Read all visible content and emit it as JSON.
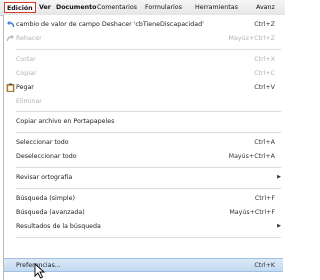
{
  "menubar": {
    "items": [
      "Edición",
      "Ver",
      "Documento",
      "Comentarios",
      "Formularios",
      "Herramientas",
      "Avanz"
    ]
  },
  "menu": {
    "undo": {
      "label": "cambio de valor de campo Deshacer 'cbTieneDiscapacidad'",
      "shortcut": "Ctrl+Z",
      "icon": "undo-icon"
    },
    "redo": {
      "label": "Rehacer",
      "shortcut": "Mayús+Ctrl+Z",
      "icon": "redo-icon"
    },
    "cut": {
      "label": "Cortar",
      "shortcut": "Ctrl+X"
    },
    "copy": {
      "label": "Copiar",
      "shortcut": "Ctrl+C"
    },
    "paste": {
      "label": "Pegar",
      "shortcut": "Ctrl+V",
      "icon": "clipboard-icon"
    },
    "delete": {
      "label": "Eliminar"
    },
    "copy_file": {
      "label": "Copiar archivo en Portapapeles"
    },
    "select_all": {
      "label": "Seleccionar todo",
      "shortcut": "Ctrl+A"
    },
    "deselect_all": {
      "label": "Deseleccionar todo",
      "shortcut": "Mayús+Ctrl+A"
    },
    "spelling": {
      "label": "Revisar ortografía"
    },
    "search_simple": {
      "label": "Búsqueda (simple)",
      "shortcut": "Ctrl+F"
    },
    "search_advanced": {
      "label": "Búsqueda (avanzada)",
      "shortcut": "Mayús+Ctrl+F"
    },
    "search_results": {
      "label": "Resultados de la búsqueda"
    },
    "preferences": {
      "label": "Preferencias...",
      "shortcut": "Ctrl+K"
    }
  },
  "colors": {
    "highlight": "#c3daf1",
    "active_border": "#d23a2a",
    "disabled_text": "#b2b2b2"
  }
}
